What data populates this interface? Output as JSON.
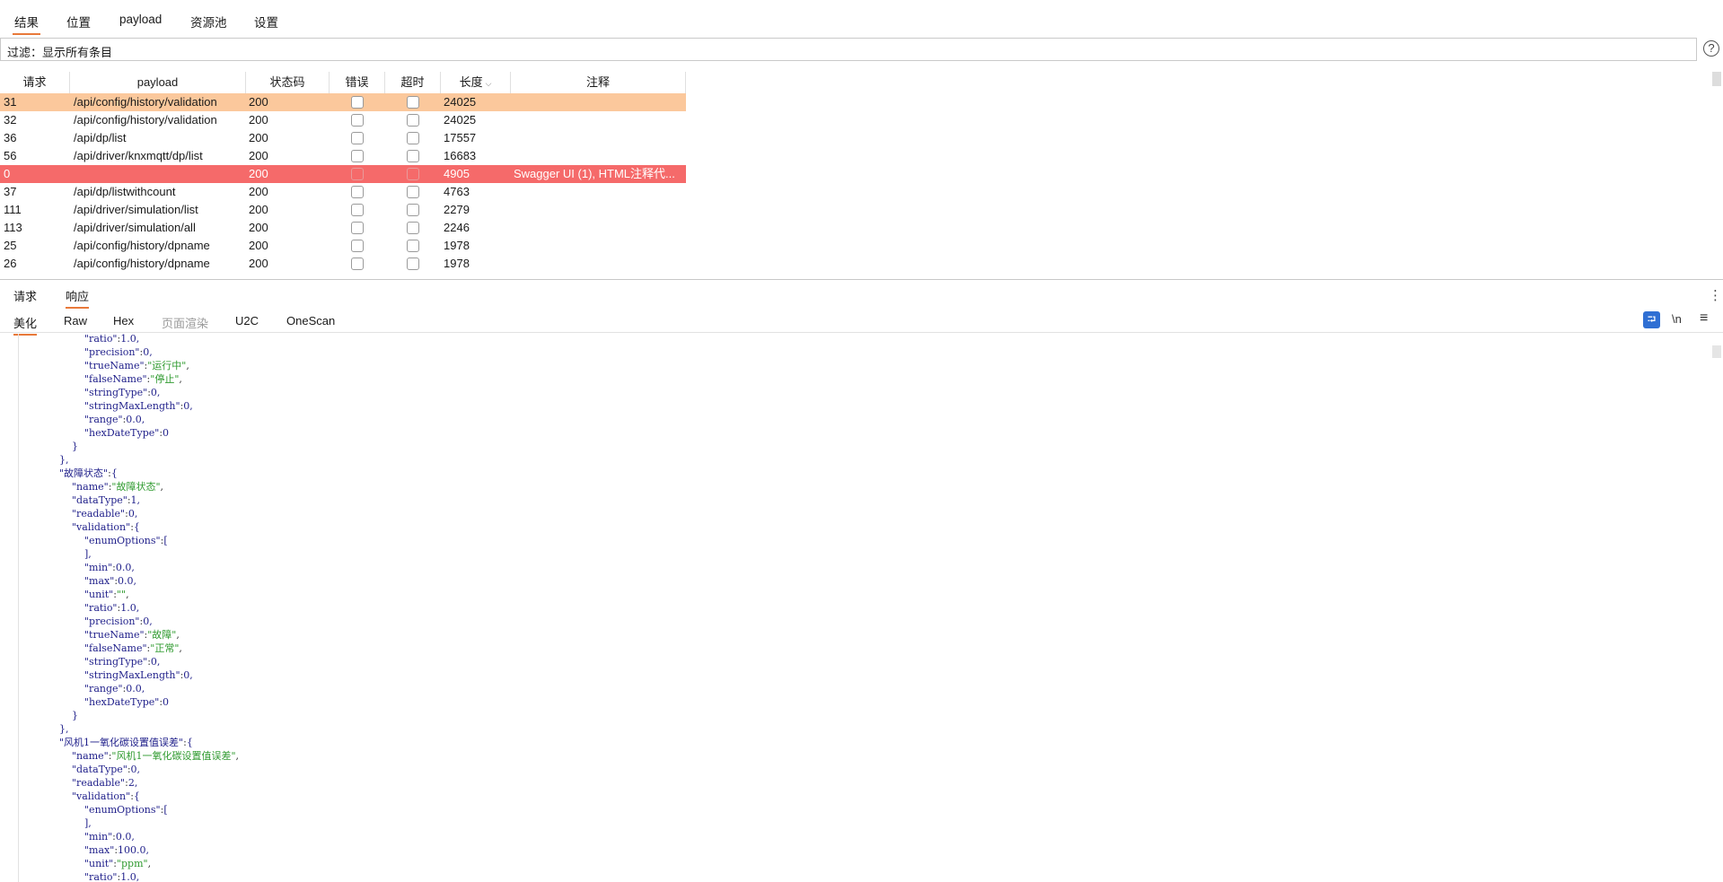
{
  "main_tabs": [
    "结果",
    "位置",
    "payload",
    "资源池",
    "设置"
  ],
  "filter": {
    "label": "过滤：显示所有条目"
  },
  "table": {
    "headers": [
      "请求",
      "payload",
      "状态码",
      "错误",
      "超时",
      "长度",
      "注释"
    ],
    "rows": [
      {
        "req": "31",
        "payload": "/api/config/history/validation",
        "status": "200",
        "length": "24025",
        "comment": "",
        "style": "sel"
      },
      {
        "req": "32",
        "payload": "/api/config/history/validation",
        "status": "200",
        "length": "24025",
        "comment": "",
        "style": ""
      },
      {
        "req": "36",
        "payload": "/api/dp/list",
        "status": "200",
        "length": "17557",
        "comment": "",
        "style": ""
      },
      {
        "req": "56",
        "payload": "/api/driver/knxmqtt/dp/list",
        "status": "200",
        "length": "16683",
        "comment": "",
        "style": ""
      },
      {
        "req": "0",
        "payload": "",
        "status": "200",
        "length": "4905",
        "comment": "Swagger UI (1), HTML注释代...",
        "style": "red"
      },
      {
        "req": "37",
        "payload": "/api/dp/listwithcount",
        "status": "200",
        "length": "4763",
        "comment": "",
        "style": ""
      },
      {
        "req": "111",
        "payload": "/api/driver/simulation/list",
        "status": "200",
        "length": "2279",
        "comment": "",
        "style": ""
      },
      {
        "req": "113",
        "payload": "/api/driver/simulation/all",
        "status": "200",
        "length": "2246",
        "comment": "",
        "style": ""
      },
      {
        "req": "25",
        "payload": "/api/config/history/dpname",
        "status": "200",
        "length": "1978",
        "comment": "",
        "style": ""
      },
      {
        "req": "26",
        "payload": "/api/config/history/dpname",
        "status": "200",
        "length": "1978",
        "comment": "",
        "style": ""
      }
    ]
  },
  "sub_tabs": [
    "请求",
    "响应"
  ],
  "view_tabs": [
    "美化",
    "Raw",
    "Hex",
    "页面渲染",
    "U2C",
    "OneScan"
  ],
  "toolbar": {
    "newline_label": "\\n",
    "wrap_icon": "wrap-icon",
    "menu_icon": "hamburger-icon"
  },
  "code_lines": [
    {
      "indent": 6,
      "text": "\"ratio\":1.0,"
    },
    {
      "indent": 6,
      "text": "\"precision\":0,"
    },
    {
      "indent": 6,
      "text": "\"trueName\":\"运行中\","
    },
    {
      "indent": 6,
      "text": "\"falseName\":\"停止\","
    },
    {
      "indent": 6,
      "text": "\"stringType\":0,"
    },
    {
      "indent": 6,
      "text": "\"stringMaxLength\":0,"
    },
    {
      "indent": 6,
      "text": "\"range\":0.0,"
    },
    {
      "indent": 6,
      "text": "\"hexDateType\":0"
    },
    {
      "indent": 4,
      "text": "}"
    },
    {
      "indent": 2,
      "text": "},"
    },
    {
      "indent": 2,
      "text": "\"故障状态\":{"
    },
    {
      "indent": 4,
      "text": "\"name\":\"故障状态\","
    },
    {
      "indent": 4,
      "text": "\"dataType\":1,"
    },
    {
      "indent": 4,
      "text": "\"readable\":0,"
    },
    {
      "indent": 4,
      "text": "\"validation\":{"
    },
    {
      "indent": 6,
      "text": "\"enumOptions\":["
    },
    {
      "indent": 6,
      "text": "],"
    },
    {
      "indent": 6,
      "text": "\"min\":0.0,"
    },
    {
      "indent": 6,
      "text": "\"max\":0.0,"
    },
    {
      "indent": 6,
      "text": "\"unit\":\"\","
    },
    {
      "indent": 6,
      "text": "\"ratio\":1.0,"
    },
    {
      "indent": 6,
      "text": "\"precision\":0,"
    },
    {
      "indent": 6,
      "text": "\"trueName\":\"故障\","
    },
    {
      "indent": 6,
      "text": "\"falseName\":\"正常\","
    },
    {
      "indent": 6,
      "text": "\"stringType\":0,"
    },
    {
      "indent": 6,
      "text": "\"stringMaxLength\":0,"
    },
    {
      "indent": 6,
      "text": "\"range\":0.0,"
    },
    {
      "indent": 6,
      "text": "\"hexDateType\":0"
    },
    {
      "indent": 4,
      "text": "}"
    },
    {
      "indent": 2,
      "text": "},"
    },
    {
      "indent": 2,
      "text": "\"风机1一氧化碳设置值误差\":{"
    },
    {
      "indent": 4,
      "text": "\"name\":\"风机1一氧化碳设置值误差\","
    },
    {
      "indent": 4,
      "text": "\"dataType\":0,"
    },
    {
      "indent": 4,
      "text": "\"readable\":2,"
    },
    {
      "indent": 4,
      "text": "\"validation\":{"
    },
    {
      "indent": 6,
      "text": "\"enumOptions\":["
    },
    {
      "indent": 6,
      "text": "],"
    },
    {
      "indent": 6,
      "text": "\"min\":0.0,"
    },
    {
      "indent": 6,
      "text": "\"max\":100.0,"
    },
    {
      "indent": 6,
      "text": "\"unit\":\"ppm\","
    },
    {
      "indent": 6,
      "text": "\"ratio\":1.0,"
    }
  ]
}
